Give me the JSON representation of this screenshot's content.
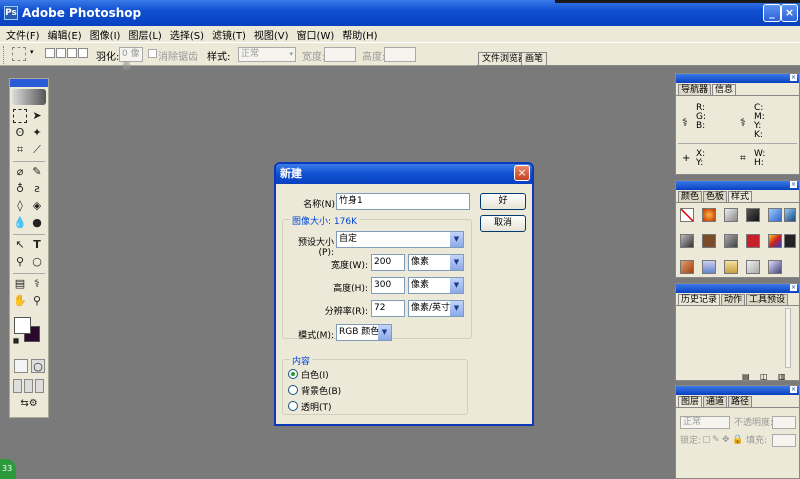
{
  "app": {
    "title": "Adobe Photoshop",
    "icon": "ps-icon"
  },
  "window_buttons": {
    "minimize": "_",
    "maximize": "□",
    "close": "×"
  },
  "menu": [
    "文件(F)",
    "编辑(E)",
    "图像(I)",
    "图层(L)",
    "选择(S)",
    "滤镜(T)",
    "视图(V)",
    "窗口(W)",
    "帮助(H)"
  ],
  "options": {
    "feather_label": "羽化:",
    "feather_value": "0 像素",
    "antialias_label": "消除锯齿",
    "style_label": "样式:",
    "style_value": "正常",
    "width_label": "宽度:",
    "height_label": "高度:",
    "tab_browser": "文件浏览器",
    "tab_brushes": "画笔"
  },
  "panels": {
    "nav": {
      "tab1": "导航器",
      "tab2": "信息",
      "r": "R:",
      "g": "G:",
      "b": "B:",
      "c": "C:",
      "m": "M:",
      "y": "Y:",
      "k": "K:",
      "x": "X:",
      "yy": "Y:",
      "w": "W:",
      "h": "H:"
    },
    "color": {
      "tab1": "颜色",
      "tab2": "色板",
      "tab3": "样式"
    },
    "history": {
      "tab1": "历史记录",
      "tab2": "动作",
      "tab3": "工具预设"
    },
    "layers": {
      "tab1": "图层",
      "tab2": "通道",
      "tab3": "路径",
      "blend": "正常",
      "opacity_label": "不透明度:",
      "lock_label": "锁定:",
      "fill_label": "填充:"
    }
  },
  "dialog": {
    "title": "新建",
    "name_label": "名称(N):",
    "name_value": "竹身1",
    "image_size_label": "图像大小: 176K",
    "preset_label": "预设大小(P):",
    "preset_value": "自定",
    "width_label": "宽度(W):",
    "width_value": "200",
    "width_unit": "像素",
    "height_label": "高度(H):",
    "height_value": "300",
    "height_unit": "像素",
    "resolution_label": "分辨率(R):",
    "resolution_value": "72",
    "resolution_unit": "像素/英寸",
    "mode_label": "模式(M):",
    "mode_value": "RGB 颜色",
    "ok_label": "好",
    "cancel_label": "取消",
    "content_label": "内容",
    "content_options": [
      "白色(I)",
      "背景色(B)",
      "透明(T)"
    ],
    "content_selected": 0
  },
  "taskbar_badge": "33",
  "colors": {
    "titlebar": "#0840c0",
    "workspace": "#7a7a7a",
    "panel_bg": "#ece9d8",
    "foreground": "#ffffff",
    "background": "#2a0a2a"
  }
}
